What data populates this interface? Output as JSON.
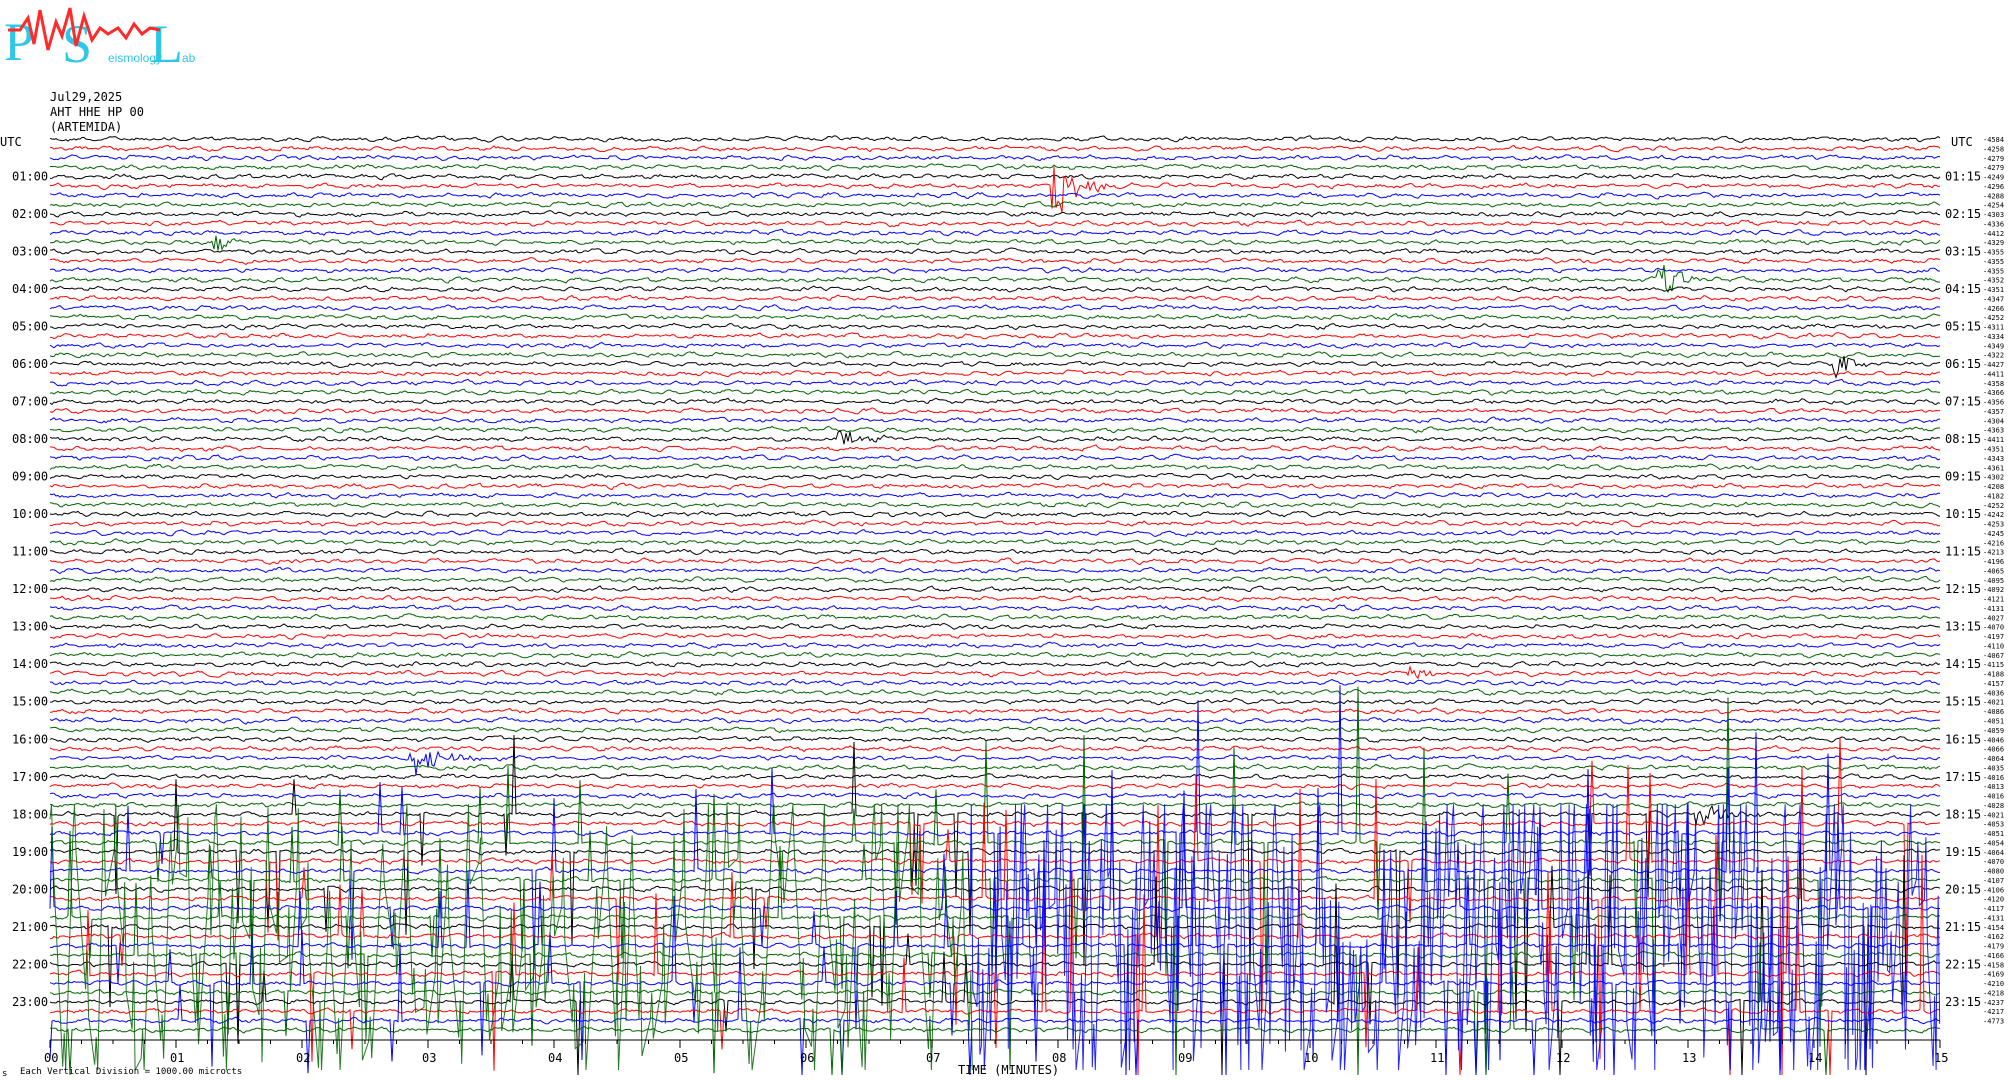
{
  "header": {
    "logo_letters": [
      "P",
      "S",
      "L"
    ],
    "logo_subtitle": "eismology",
    "logo_subtitle_2": "ab",
    "date": "Jul29,2025",
    "station": "AHT HHE HP 00",
    "site": "(ARTEMIDA)"
  },
  "left_axis_title": "UTC",
  "right_axis_title": "UTC",
  "left_hour_labels": [
    "01:00",
    "02:00",
    "03:00",
    "04:00",
    "05:00",
    "06:00",
    "07:00",
    "08:00",
    "09:00",
    "10:00",
    "11:00",
    "12:00",
    "13:00",
    "14:00",
    "15:00",
    "16:00",
    "17:00",
    "18:00",
    "19:00",
    "20:00",
    "21:00",
    "22:00",
    "23:00"
  ],
  "right_hour_labels": [
    "01:15",
    "02:15",
    "03:15",
    "04:15",
    "05:15",
    "06:15",
    "07:15",
    "08:15",
    "09:15",
    "10:15",
    "11:15",
    "12:15",
    "13:15",
    "14:15",
    "15:15",
    "16:15",
    "17:15",
    "18:15",
    "19:15",
    "20:15",
    "21:15",
    "22:15",
    "23:15"
  ],
  "trace_offsets": [
    "-4584",
    "-4258",
    "-4279",
    "-4279",
    "-4249",
    "-4296",
    "-4288",
    "-4254",
    "-4303",
    "-4336",
    "-4412",
    "-4329",
    "-4355",
    "-4355",
    "-4355",
    "-4352",
    "-4351",
    "-4347",
    "-4266",
    "-4252",
    "-4311",
    "-4334",
    "-4349",
    "-4322",
    "-4427",
    "-4411",
    "-4358",
    "-4366",
    "-4356",
    "-4357",
    "-4304",
    "-4363",
    "-4411",
    "-4351",
    "-4343",
    "-4361",
    "-4302",
    "-4208",
    "-4182",
    "-4252",
    "-4242",
    "-4253",
    "-4245",
    "-4216",
    "-4213",
    "-4196",
    "-4065",
    "-4095",
    "-4092",
    "-4121",
    "-4131",
    "-4027",
    "-4070",
    "-4197",
    "-4110",
    "-4067",
    "-4115",
    "-4188",
    "-4157",
    "-4036",
    "-4021",
    "-4086",
    "-4051",
    "-4059",
    "-4046",
    "-4066",
    "-4064",
    "-4035",
    "-4016",
    "-4013",
    "-4016",
    "-4028",
    "-4021",
    "-4053",
    "-4051",
    "-4054",
    "-4064",
    "-4070",
    "-4080",
    "-4107",
    "-4106",
    "-4120",
    "-4117",
    "-4131",
    "-4154",
    "-4162",
    "-4179",
    "-4166",
    "-4158",
    "-4169",
    "-4210",
    "-4218",
    "-4237",
    "-4217",
    "-4773"
  ],
  "x_axis": {
    "tick_labels": [
      "00",
      "01",
      "02",
      "03",
      "04",
      "05",
      "06",
      "07",
      "08",
      "09",
      "10",
      "11",
      "12",
      "13",
      "14",
      "15"
    ],
    "title": "TIME (MINUTES)"
  },
  "footer": {
    "scale_note": "Each Vertical Division = 1000.00 microcts",
    "left_mark": "s"
  },
  "colors": [
    "#000000",
    "#ff0000",
    "#0000ff",
    "#006400"
  ],
  "chart_data": {
    "type": "line",
    "plot_kind": "helicorder",
    "rows_count": 96,
    "minutes_per_row": 15,
    "xlim": [
      0,
      15
    ],
    "xlabel": "TIME (MINUTES)",
    "ylabel": "UTC",
    "trace_color_cycle": [
      "black",
      "red",
      "blue",
      "green"
    ],
    "events": [
      {
        "row": 5,
        "minute": 8.0,
        "color": "green",
        "strength": 3.2,
        "duration_min": 0.5
      },
      {
        "row": 11,
        "minute": 1.35,
        "color": "red",
        "strength": 0.9,
        "duration_min": 0.25
      },
      {
        "row": 15,
        "minute": 12.8,
        "color": "black",
        "strength": 2.6,
        "duration_min": 0.35
      },
      {
        "row": 24,
        "minute": 14.2,
        "color": "black",
        "strength": 1.3,
        "duration_min": 0.3
      },
      {
        "row": 32,
        "minute": 6.3,
        "color": "black",
        "strength": 0.9,
        "duration_min": 0.4
      },
      {
        "row": 57,
        "minute": 10.8,
        "color": "green",
        "strength": 0.9,
        "duration_min": 0.35
      },
      {
        "row": 66,
        "minute": 2.9,
        "color": "blue",
        "strength": 1.8,
        "duration_min": 0.6
      },
      {
        "row": 72,
        "minute": 13.1,
        "color": "black",
        "strength": 1.1,
        "duration_min": 0.8
      }
    ],
    "noise_bursts": [
      {
        "start_row": 72,
        "end_row": 95,
        "minute_start": 0.0,
        "minute_end": 7.3,
        "color": "green"
      },
      {
        "start_row": 72,
        "end_row": 95,
        "minute_start": 7.3,
        "minute_end": 15.0,
        "color": "blue"
      }
    ]
  }
}
